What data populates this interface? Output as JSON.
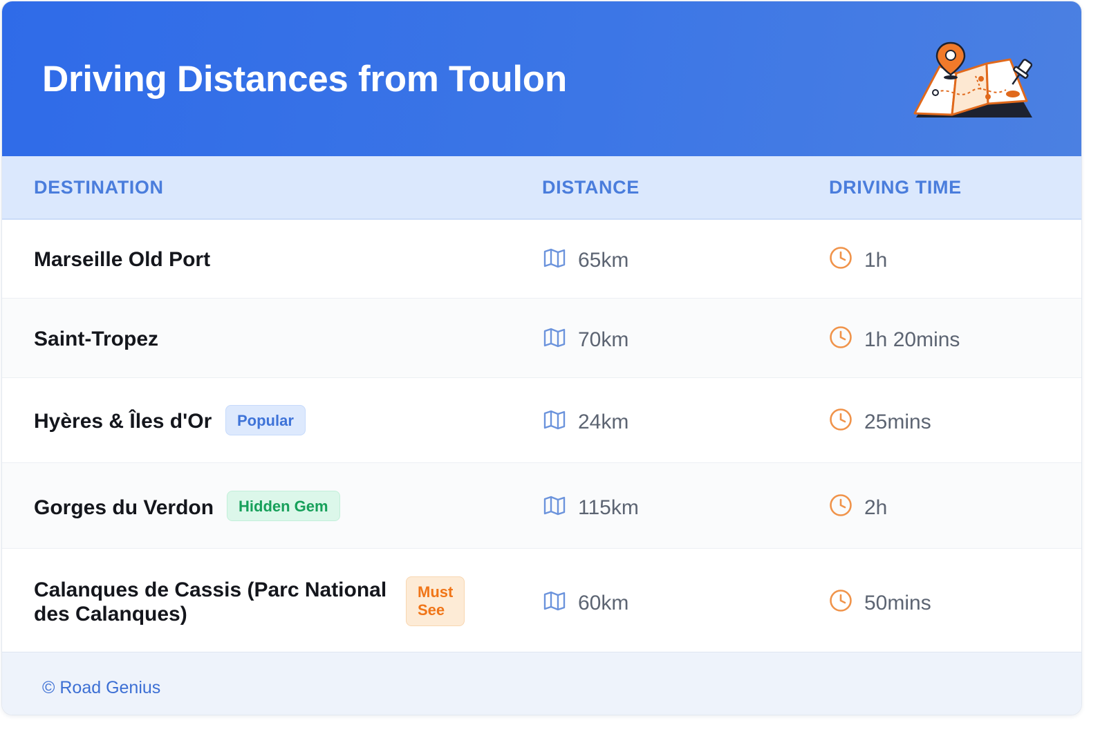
{
  "header": {
    "title": "Driving Distances from Toulon",
    "illustration_icon": "folded-map-with-pins-icon"
  },
  "columns": {
    "destination": "DESTINATION",
    "distance": "DISTANCE",
    "driving_time": "DRIVING TIME"
  },
  "rows": [
    {
      "destination": "Marseille Old Port",
      "distance": "65km",
      "time": "1h"
    },
    {
      "destination": "Saint-Tropez",
      "distance": "70km",
      "time": "1h 20mins"
    },
    {
      "destination": "Hyères & Îles d'Or",
      "badge": "Popular",
      "badge_color": "#3e73d8",
      "distance": "24km",
      "time": "25mins"
    },
    {
      "destination": "Gorges du Verdon",
      "badge": "Hidden Gem",
      "badge_color": "#17a05a",
      "distance": "115km",
      "time": "2h"
    },
    {
      "destination_line1": "Calanques de Cassis (Parc National",
      "destination_line2": "des Calanques)",
      "badge_line1": "Must",
      "badge_line2": "See",
      "badge_color": "#f07518",
      "distance": "60km",
      "time": "50mins"
    }
  ],
  "icons": {
    "distance": "map-icon",
    "time": "clock-icon"
  },
  "footer": {
    "text": "© Road Genius"
  },
  "colors": {
    "header_start": "#2f6be8",
    "header_end": "#4b80e2",
    "column_header_text": "#4a7ddc",
    "map_icon": "#6b93dc",
    "clock_icon": "#f0934a"
  }
}
